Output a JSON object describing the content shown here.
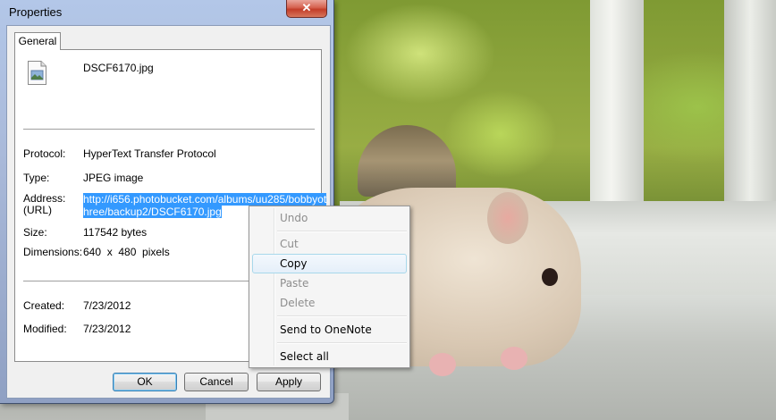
{
  "window": {
    "title": "Properties",
    "close_glyph": "✕",
    "tab_label": "General"
  },
  "file": {
    "name": "DSCF6170.jpg",
    "icon": "jpeg-file-icon"
  },
  "properties": {
    "protocol_label": "Protocol:",
    "protocol_value": "HyperText Transfer Protocol",
    "type_label": "Type:",
    "type_value": "JPEG image",
    "address_label": "Address:",
    "url_label": "(URL)",
    "address_line1": "http://i656.photobucket.com/albums/uu285/bobbyot",
    "address_line2": "hree/backup2/DSCF6170.jpg",
    "size_label": "Size:",
    "size_value": "117542 bytes",
    "dimensions_label": "Dimensions:",
    "dimensions_value": "640  x  480  pixels",
    "created_label": "Created:",
    "created_value": "7/23/2012",
    "modified_label": "Modified:",
    "modified_value": "7/23/2012"
  },
  "buttons": {
    "ok": "OK",
    "cancel": "Cancel",
    "apply": "Apply"
  },
  "context_menu": {
    "items": [
      {
        "label": "Undo",
        "enabled": false
      },
      {
        "label": "Cut",
        "enabled": false
      },
      {
        "label": "Copy",
        "enabled": true,
        "highlighted": true
      },
      {
        "label": "Paste",
        "enabled": false
      },
      {
        "label": "Delete",
        "enabled": false
      },
      {
        "label": "Send to OneNote",
        "enabled": true
      },
      {
        "label": "Select all",
        "enabled": true
      }
    ]
  },
  "colors": {
    "selection": "#3399ff",
    "close_button": "#c23d29",
    "menu_highlight_border": "#a8d8eb"
  }
}
